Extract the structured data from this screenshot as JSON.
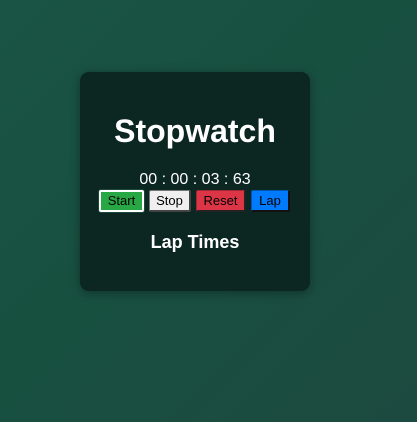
{
  "app": {
    "title": "Stopwatch"
  },
  "display": {
    "hours": "00",
    "minutes": "00",
    "seconds": "03",
    "centiseconds": "63",
    "separator": ":"
  },
  "controls": {
    "start_label": "Start",
    "stop_label": "Stop",
    "reset_label": "Reset",
    "lap_label": "Lap"
  },
  "laps": {
    "heading": "Lap Times",
    "items": []
  },
  "colors": {
    "background": "#185040",
    "card": "#0c2621",
    "start": "#28a745",
    "stop": "#efefef",
    "reset": "#dc3545",
    "lap": "#007bff",
    "text": "#ffffff"
  }
}
